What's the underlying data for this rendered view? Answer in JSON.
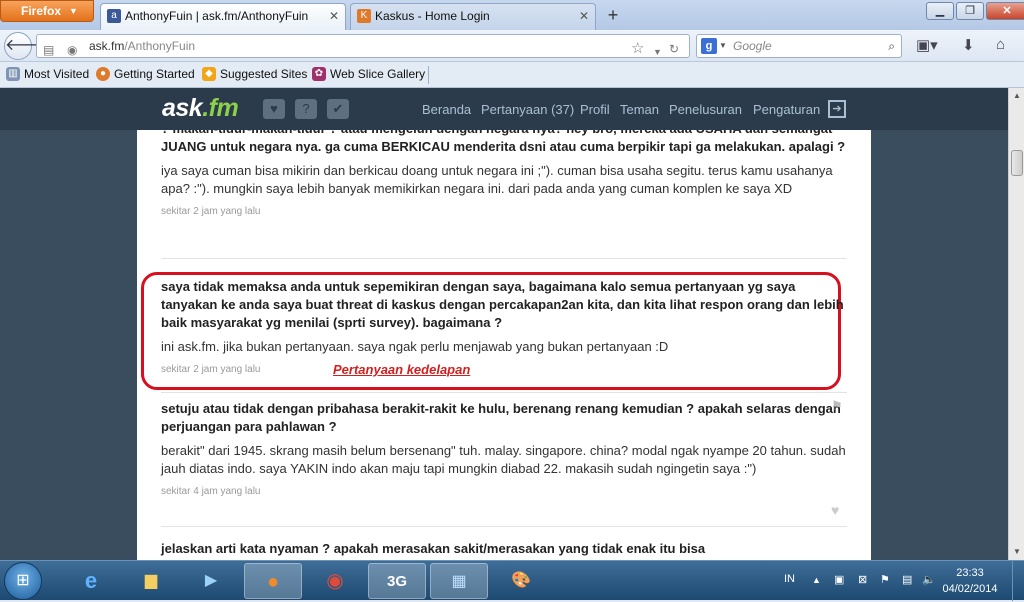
{
  "browser": {
    "menu_label": "Firefox",
    "tabs": [
      {
        "title": "AnthonyFuin | ask.fm/AnthonyFuin",
        "favicon": "a"
      },
      {
        "title": "Kaskus - Home Login",
        "favicon": "K"
      }
    ],
    "url_domain": "ask.fm",
    "url_path": "/AnthonyFuin",
    "search_placeholder": "Google",
    "bookmarks": [
      "Most Visited",
      "Getting Started",
      "Suggested Sites",
      "Web Slice Gallery"
    ]
  },
  "site": {
    "logo_text": "ask",
    "logo_suffix": ".fm",
    "nav": {
      "beranda": "Beranda",
      "pertanyaan": "Pertanyaan (37)",
      "profil": "Profil",
      "teman": "Teman",
      "penelusuran": "Penelusuran",
      "pengaturan": "Pengaturan"
    }
  },
  "posts": [
    {
      "question": "? makan-tidur-makan-tidur ? atau mengeluh dengan negara nya? hey bro, mereka ada USAHA dan semangat JUANG untuk negara nya. ga cuma BERKICAU menderita dsni atau cuma berpikir tapi ga melakukan. apalagi ?",
      "answer": "iya saya cuman bisa mikirin dan berkicau doang untuk negara ini ;\"). cuman bisa usaha segitu. terus kamu usahanya apa? :\"). mungkin saya lebih banyak memikirkan negara ini. dari pada anda yang cuman komplen ke saya XD",
      "time": "sekitar 2 jam yang lalu"
    },
    {
      "question": "saya tidak memaksa anda untuk sepemikiran dengan saya, bagaimana kalo semua pertanyaan yg saya tanyakan ke anda saya buat threat di kaskus dengan percakapan2an kita, dan kita lihat respon orang dan lebih baik masyarakat yg menilai (sprti survey). bagaimana ?",
      "answer": "ini ask.fm. jika bukan pertanyaan. saya ngak perlu menjawab yang bukan pertanyaan :D",
      "time": "sekitar 2 jam yang lalu"
    },
    {
      "question": "setuju atau tidak dengan pribahasa berakit-rakit ke hulu, berenang renang kemudian ? apakah selaras dengan perjuangan para pahlawan ?",
      "answer": "berakit\" dari 1945. skrang masih belum bersenang\" tuh. malay. singapore. china? modal ngak nyampe 20 tahun. sudah jauh diatas indo. saya YAKIN indo akan maju tapi mungkin diabad 22. makasih sudah ngingetin saya :\")",
      "time": "sekitar 4 jam yang lalu"
    },
    {
      "question": "jelaskan arti kata nyaman ? apakah merasakan sakit/merasakan yang tidak enak itu bisa"
    }
  ],
  "annotation": "Pertanyaan kedelapan",
  "taskbar": {
    "lang": "IN",
    "time": "23:33",
    "date": "04/02/2014"
  },
  "colors": {
    "highlight": "#d6101f",
    "site_bar": "#2b3b4b",
    "logo_accent": "#8dd04a"
  }
}
